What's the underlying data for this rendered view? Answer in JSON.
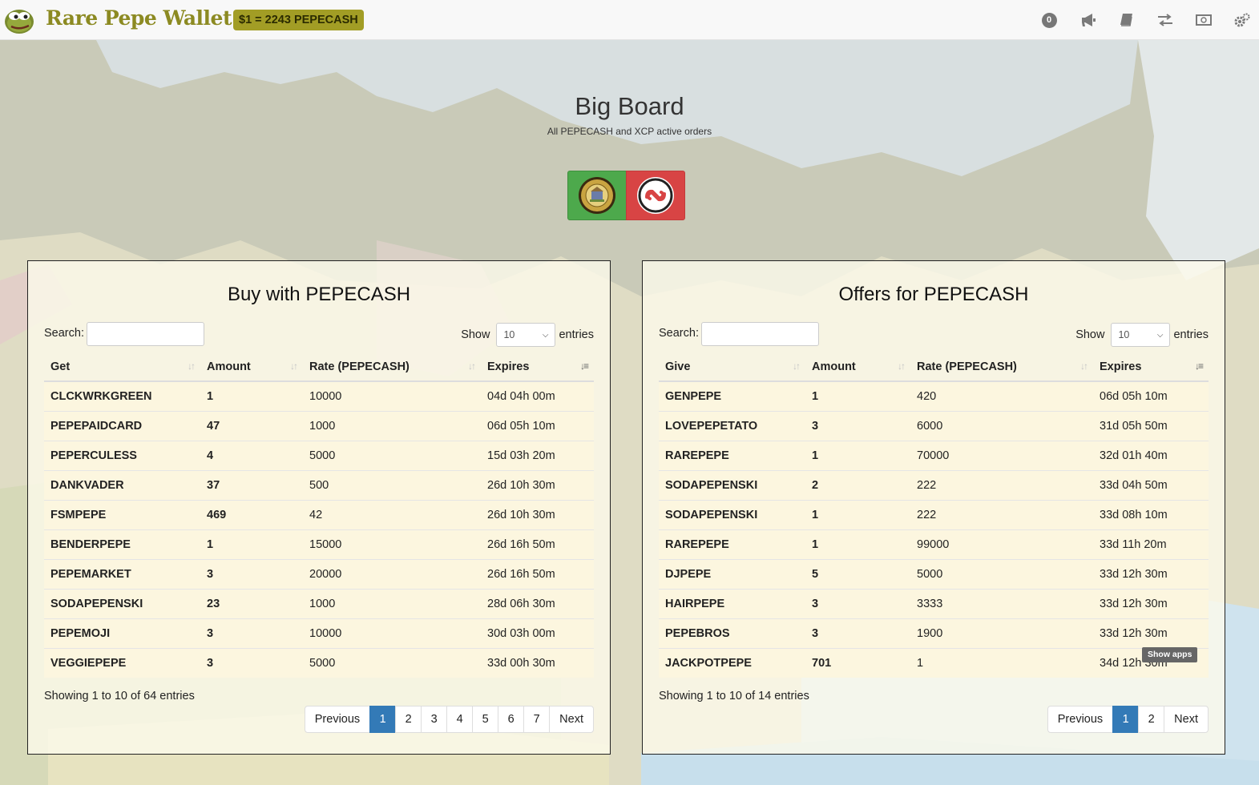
{
  "nav": {
    "brand": "Rare Pepe Wallet",
    "rate_badge": "$1 = 2243 PEPECASH",
    "notification_count": "0",
    "icons": [
      "megaphone-icon",
      "book-icon",
      "exchange-icon",
      "money-icon",
      "gears-icon"
    ]
  },
  "page": {
    "title": "Big Board",
    "subtitle": "All PEPECASH and XCP active orders"
  },
  "buy_panel": {
    "title": "Buy with PEPECASH",
    "search_label": "Search:",
    "show_label": "Show",
    "show_value": "10",
    "entries_label": "entries",
    "columns": [
      "Get",
      "Amount",
      "Rate (PEPECASH)",
      "Expires"
    ],
    "rows": [
      [
        "CLCKWRKGREEN",
        "1",
        "10000",
        "04d 04h 00m"
      ],
      [
        "PEPEPAIDCARD",
        "47",
        "1000",
        "06d 05h 10m"
      ],
      [
        "PEPERCULESS",
        "4",
        "5000",
        "15d 03h 20m"
      ],
      [
        "DANKVADER",
        "37",
        "500",
        "26d 10h 30m"
      ],
      [
        "FSMPEPE",
        "469",
        "42",
        "26d 10h 30m"
      ],
      [
        "BENDERPEPE",
        "1",
        "15000",
        "26d 16h 50m"
      ],
      [
        "PEPEMARKET",
        "3",
        "20000",
        "26d 16h 50m"
      ],
      [
        "SODAPEPENSKI",
        "23",
        "1000",
        "28d 06h 30m"
      ],
      [
        "PEPEMOJI",
        "3",
        "10000",
        "30d 03h 00m"
      ],
      [
        "VEGGIEPEPE",
        "3",
        "5000",
        "33d 00h 30m"
      ]
    ],
    "info": "Showing 1 to 10 of 64 entries",
    "pagination": {
      "previous": "Previous",
      "pages": [
        "1",
        "2",
        "3",
        "4",
        "5",
        "6",
        "7"
      ],
      "active": "1",
      "next": "Next"
    }
  },
  "offer_panel": {
    "title": "Offers for PEPECASH",
    "search_label": "Search:",
    "show_label": "Show",
    "show_value": "10",
    "entries_label": "entries",
    "columns": [
      "Give",
      "Amount",
      "Rate (PEPECASH)",
      "Expires"
    ],
    "rows": [
      [
        "GENPEPE",
        "1",
        "420",
        "06d 05h 10m"
      ],
      [
        "LOVEPEPETATO",
        "3",
        "6000",
        "31d 05h 50m"
      ],
      [
        "RAREPEPE",
        "1",
        "70000",
        "32d 01h 40m"
      ],
      [
        "SODAPEPENSKI",
        "2",
        "222",
        "33d 04h 50m"
      ],
      [
        "SODAPEPENSKI",
        "1",
        "222",
        "33d 08h 10m"
      ],
      [
        "RAREPEPE",
        "1",
        "99000",
        "33d 11h 20m"
      ],
      [
        "DJPEPE",
        "5",
        "5000",
        "33d 12h 30m"
      ],
      [
        "HAIRPEPE",
        "3",
        "3333",
        "33d 12h 30m"
      ],
      [
        "PEPEBROS",
        "3",
        "1900",
        "33d 12h 30m"
      ],
      [
        "JACKPOTPEPE",
        "701",
        "1",
        "34d 12h 30m"
      ]
    ],
    "info": "Showing 1 to 10 of 14 entries",
    "pagination": {
      "previous": "Previous",
      "pages": [
        "1",
        "2"
      ],
      "active": "1",
      "next": "Next"
    }
  },
  "tooltip": "Show apps",
  "colors": {
    "brand": "#8c8a22",
    "badge": "#a29d25",
    "pepecash_button": "#4da94c",
    "xcp_button": "#d84444",
    "page_active": "#337ab7"
  }
}
